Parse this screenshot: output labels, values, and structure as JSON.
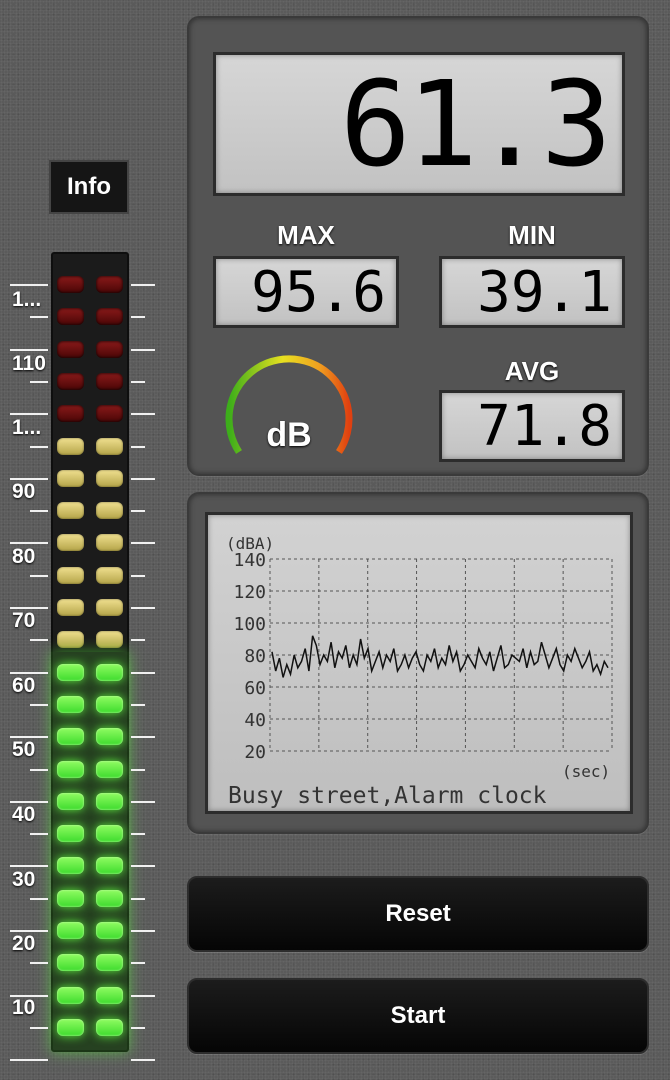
{
  "info_button": {
    "label": "Info"
  },
  "meter": {
    "scale_labels": [
      "1...",
      "110",
      "1...",
      "90",
      "80",
      "70",
      "60",
      "50",
      "40",
      "30",
      "20",
      "10"
    ],
    "rows": 24,
    "lit_rows_green": 12,
    "yellow_rows": 7,
    "red_rows": 5,
    "colors": {
      "red": "#6a0d0d",
      "yellow": "#d8c870",
      "green": "#5ef23c"
    }
  },
  "display": {
    "current": "61.3",
    "max_label": "MAX",
    "max_value": "95.6",
    "min_label": "MIN",
    "min_value": "39.1",
    "avg_label": "AVG",
    "avg_value": "71.8",
    "gauge_unit": "dB"
  },
  "graph": {
    "unit_label": "(dBA)",
    "y_ticks": [
      "140",
      "120",
      "100",
      "80",
      "60",
      "40",
      "20"
    ],
    "x_unit_label": "(sec)",
    "caption": "Busy street,Alarm clock",
    "chart_data": {
      "type": "line",
      "ylim": [
        20,
        140
      ],
      "values": [
        82,
        70,
        78,
        66,
        74,
        68,
        80,
        72,
        76,
        84,
        70,
        92,
        86,
        74,
        80,
        76,
        88,
        72,
        82,
        78,
        86,
        72,
        80,
        74,
        90,
        78,
        84,
        70,
        76,
        82,
        72,
        80,
        76,
        84,
        70,
        74,
        80,
        72,
        78,
        82,
        74,
        70,
        80,
        76,
        84,
        72,
        78,
        74,
        86,
        76,
        82,
        70,
        74,
        80,
        76,
        72,
        84,
        78,
        74,
        82,
        70,
        78,
        86,
        72,
        74,
        80,
        78,
        76,
        84,
        72,
        82,
        74,
        76,
        88,
        80,
        72,
        78,
        84,
        74,
        70,
        80,
        76,
        84,
        78,
        72,
        76,
        82,
        70,
        74,
        68,
        76,
        72
      ]
    }
  },
  "buttons": {
    "reset": "Reset",
    "start": "Start"
  }
}
